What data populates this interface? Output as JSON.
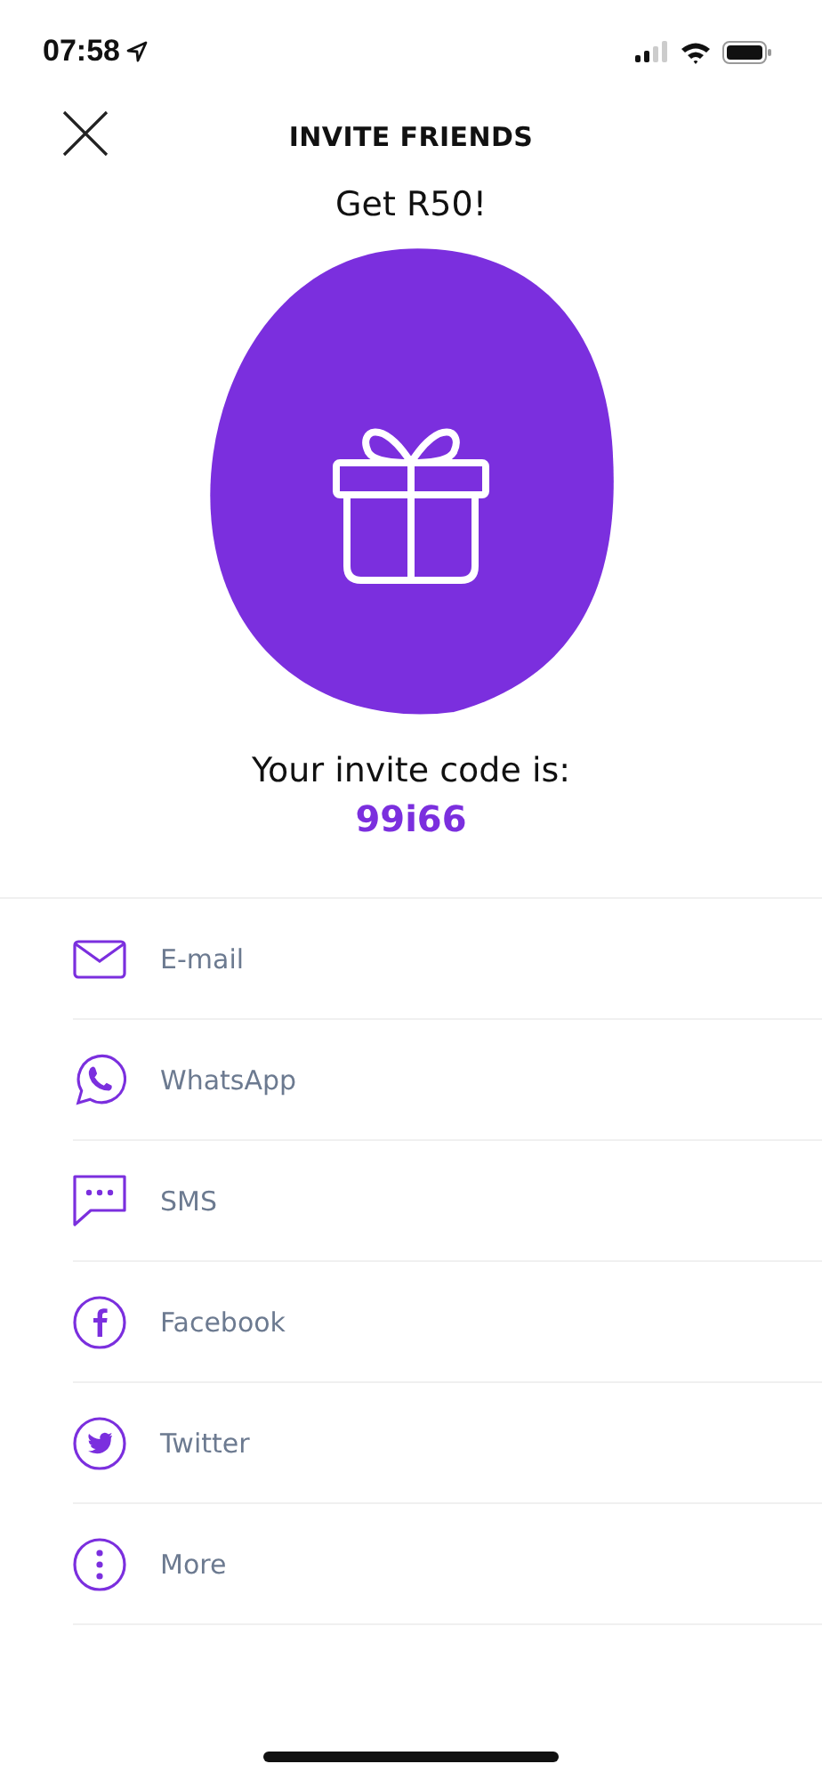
{
  "status_bar": {
    "time": "07:58"
  },
  "header": {
    "title": "INVITE FRIENDS"
  },
  "reward": {
    "headline": "Get R50!",
    "code_label": "Your invite code is:",
    "code": "99i66"
  },
  "share_options": [
    {
      "kind": "email",
      "label": "E-mail"
    },
    {
      "kind": "whatsapp",
      "label": "WhatsApp"
    },
    {
      "kind": "sms",
      "label": "SMS"
    },
    {
      "kind": "facebook",
      "label": "Facebook"
    },
    {
      "kind": "twitter",
      "label": "Twitter"
    },
    {
      "kind": "more",
      "label": "More"
    }
  ]
}
